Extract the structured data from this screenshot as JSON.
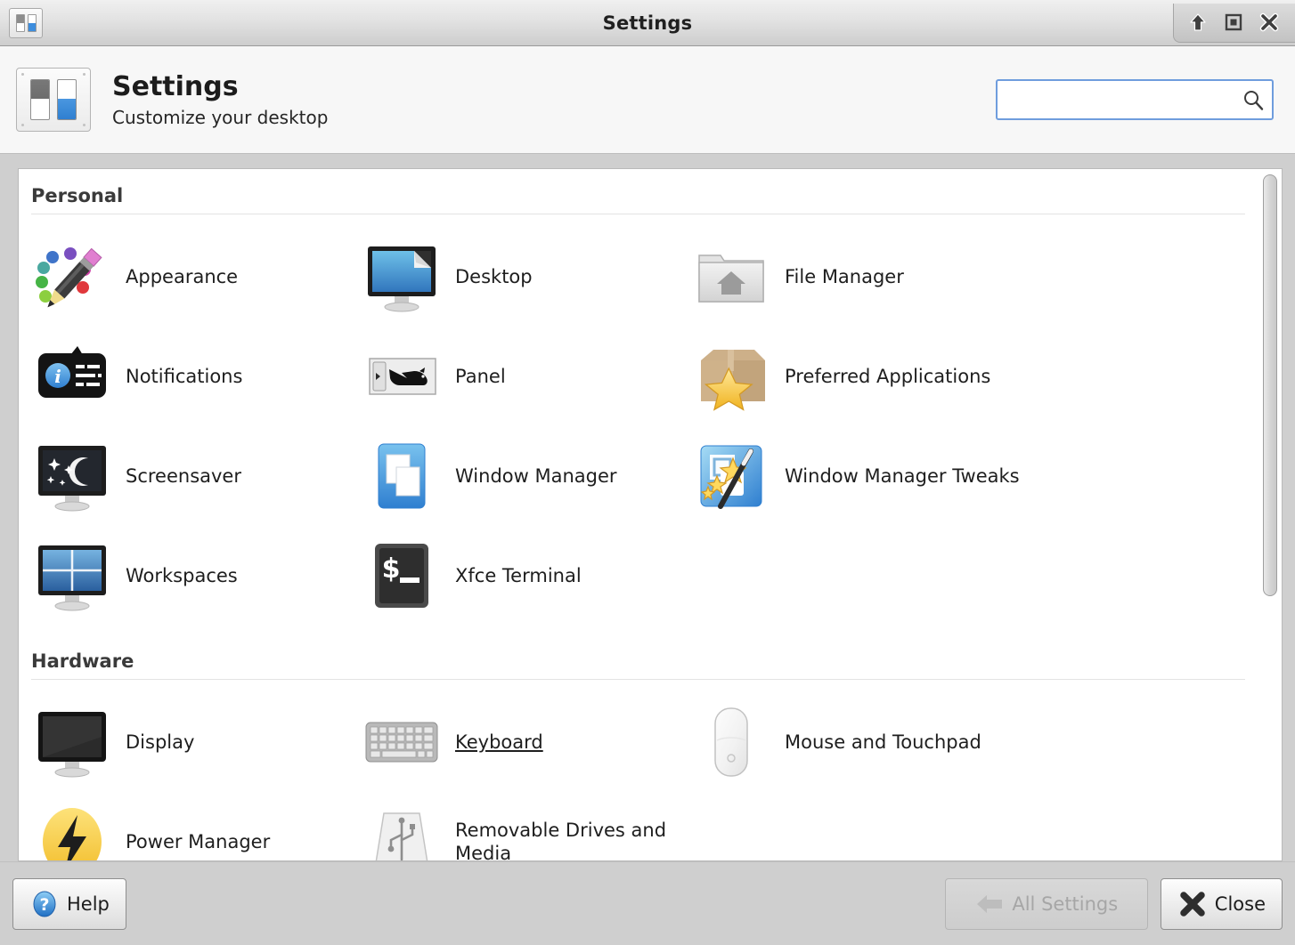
{
  "window": {
    "title": "Settings",
    "app_icon": "settings-sliders-icon",
    "controls": [
      {
        "name": "shade-button",
        "icon": "up-arrow-icon"
      },
      {
        "name": "maximize-button",
        "icon": "maximize-square-icon"
      },
      {
        "name": "close-button",
        "icon": "close-x-icon"
      }
    ]
  },
  "header": {
    "title": "Settings",
    "subtitle": "Customize your desktop",
    "icon": "settings-sliders-icon",
    "search": {
      "value": "",
      "placeholder": "",
      "icon": "search-icon"
    }
  },
  "sections": [
    {
      "id": "personal",
      "title": "Personal",
      "items": [
        {
          "label": "Appearance",
          "icon": "appearance-pencil-icon",
          "underlined": false
        },
        {
          "label": "Desktop",
          "icon": "desktop-monitor-icon",
          "underlined": false
        },
        {
          "label": "File Manager",
          "icon": "file-manager-folder-icon",
          "underlined": false
        },
        {
          "label": "Notifications",
          "icon": "notifications-bubble-icon",
          "underlined": false
        },
        {
          "label": "Panel",
          "icon": "panel-bar-icon",
          "underlined": false
        },
        {
          "label": "Preferred Applications",
          "icon": "preferred-apps-box-star-icon",
          "underlined": false
        },
        {
          "label": "Screensaver",
          "icon": "screensaver-moon-icon",
          "underlined": false
        },
        {
          "label": "Window Manager",
          "icon": "window-manager-windows-icon",
          "underlined": false
        },
        {
          "label": "Window Manager Tweaks",
          "icon": "window-manager-tweaks-wand-icon",
          "underlined": false
        },
        {
          "label": "Workspaces",
          "icon": "workspaces-grid-icon",
          "underlined": false
        },
        {
          "label": "Xfce Terminal",
          "icon": "terminal-prompt-icon",
          "underlined": false
        }
      ]
    },
    {
      "id": "hardware",
      "title": "Hardware",
      "items": [
        {
          "label": "Display",
          "icon": "display-monitor-icon",
          "underlined": false
        },
        {
          "label": "Keyboard",
          "icon": "keyboard-icon",
          "underlined": true
        },
        {
          "label": "Mouse and Touchpad",
          "icon": "mouse-icon",
          "underlined": false
        },
        {
          "label": "Power Manager",
          "icon": "power-bolt-icon",
          "underlined": false
        },
        {
          "label": "Removable Drives and Media",
          "icon": "usb-drive-icon",
          "underlined": false
        }
      ]
    }
  ],
  "scrollbar": {
    "orientation": "vertical",
    "thumb_position_percent": 0,
    "thumb_size_percent": 62
  },
  "footer": {
    "help_label": "Help",
    "help_icon": "help-question-icon",
    "all_settings_label": "All Settings",
    "all_settings_icon": "back-arrow-icon",
    "all_settings_disabled": true,
    "close_label": "Close",
    "close_icon": "close-x-icon"
  },
  "colors": {
    "accent_blue": "#3d8ddd",
    "focus_border": "#6f9ddd",
    "window_bg": "#cfcfcf",
    "panel_bg": "#ffffff",
    "header_bg": "#f7f7f7",
    "text": "#1e1e1e"
  }
}
